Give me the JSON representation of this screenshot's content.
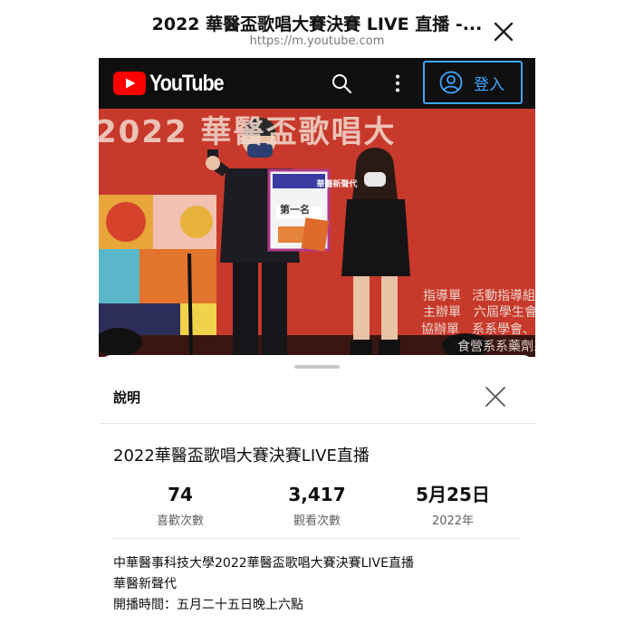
{
  "browser": {
    "title": "2022 華醫盃歌唱大賽決賽 LIVE 直播 -...",
    "url": "https://m.youtube.com",
    "close_icon": "close-icon"
  },
  "youtube_header": {
    "logo_text": "YouTube",
    "signin_label": "登入",
    "icons": [
      "search-icon",
      "more-vert-icon",
      "account-circle-icon"
    ],
    "accent_color": "#3ea6ff",
    "brand_red": "#ff0000"
  },
  "video": {
    "banner_text": "2022 華醫盃歌唱大",
    "card_title": "華醫新聲代",
    "card_award": "第一名",
    "backdrop_lines": [
      "指導單",
      "活動指導組",
      "主辦單",
      "六屆學生會",
      "協辦單",
      "系系學會、醫技系系",
      "食營系系",
      "藥劑系"
    ]
  },
  "description_sheet": {
    "heading": "說明",
    "video_title": "2022華醫盃歌唱大賽決賽LIVE直播",
    "stats": [
      {
        "value": "74",
        "label": "喜歡次數"
      },
      {
        "value": "3,417",
        "label": "觀看次數"
      },
      {
        "value": "5月25日",
        "label": "2022年"
      }
    ],
    "description_lines": [
      "中華醫事科技大學2022華醫盃歌唱大賽決賽LIVE直播",
      "華醫新聲代",
      "開播時間：五月二十五日晚上六點"
    ]
  }
}
